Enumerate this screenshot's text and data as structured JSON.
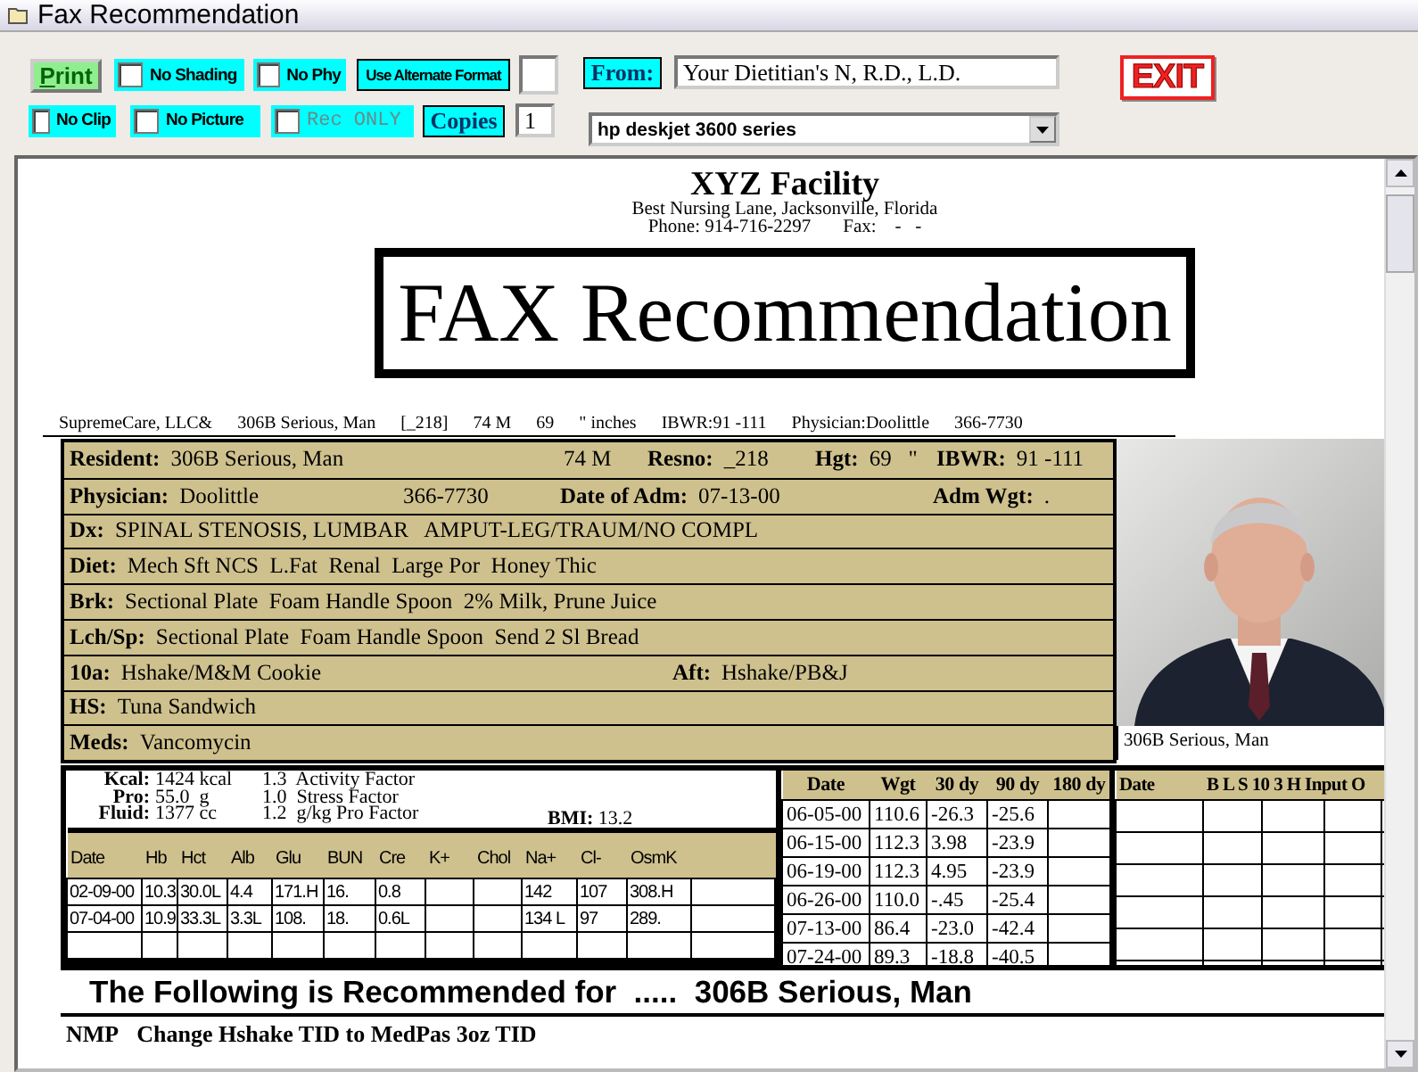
{
  "window": {
    "title": "Fax Recommendation"
  },
  "toolbar": {
    "print": "Print",
    "row1_options": [
      {
        "label": "No Shading",
        "checked": false,
        "disabled": false
      },
      {
        "label": "No Phy",
        "checked": false,
        "disabled": false
      }
    ],
    "alternate_format": "Use Alternate Format",
    "from_label": "From:",
    "from_value": "Your Dietitian's N, R.D., L.D.",
    "exit": "EXIT",
    "row2_options": [
      {
        "label": "No Clip",
        "checked": false,
        "disabled": false
      },
      {
        "label": "No Picture",
        "checked": false,
        "disabled": false
      },
      {
        "label": "Rec ONLY",
        "checked": false,
        "disabled": true
      }
    ],
    "copies_label": "Copies",
    "copies": "1",
    "printer": "hp deskjet 3600 series"
  },
  "facility": {
    "name": "XYZ Facility",
    "address": "Best Nursing Lane, Jacksonville, Florida",
    "phone": "Phone: 914-716-2297",
    "fax": "Fax:    -   -"
  },
  "title": "FAX Recommendation",
  "summary": [
    "SupremeCare, LLC&",
    "306B Serious, Man",
    "[_218]",
    "74 M",
    "69",
    "\" inches",
    "IBWR:91 -111",
    "Physician:Doolittle",
    "366-7730"
  ],
  "resident_rows": [
    [
      {
        "label": "Resident:",
        "value": "306B Serious, Man"
      },
      {
        "value": "74 M"
      },
      {
        "label": "Resno:",
        "value": "_218"
      },
      {
        "label": "Hgt:",
        "value": "69   \""
      },
      {
        "label": "IBWR:",
        "value": "91 -111"
      }
    ],
    [
      {
        "label": "Physician:",
        "value": "Doolittle"
      },
      {
        "value": "366-7730"
      },
      {
        "label": "Date of Adm:",
        "value": "07-13-00"
      },
      {
        "label": "Adm Wgt:",
        "value": "."
      }
    ],
    [
      {
        "label": "Dx:",
        "value": "SPINAL STENOSIS, LUMBAR   AMPUT-LEG/TRAUM/NO COMPL"
      }
    ],
    [
      {
        "label": "Diet:",
        "value": "Mech Sft NCS  L.Fat  Renal  Large Por  Honey Thic"
      }
    ],
    [
      {
        "label": "Brk:",
        "value": "Sectional Plate  Foam Handle Spoon  2% Milk, Prune Juice"
      }
    ],
    [
      {
        "label": "Lch/Sp:",
        "value": "Sectional Plate  Foam Handle Spoon  Send 2 Sl Bread"
      }
    ],
    [
      {
        "label": "10a:",
        "value": "Hshake/M&M Cookie"
      },
      {
        "label": "Aft:",
        "value": "Hshake/PB&J"
      }
    ],
    [
      {
        "label": "HS:",
        "value": "Tuna Sandwich"
      }
    ],
    [
      {
        "label": "Meds:",
        "value": "Vancomycin"
      }
    ]
  ],
  "photo": {
    "kind": "picture",
    "caption": "306B Serious, Man"
  },
  "nutrition": {
    "lines": [
      {
        "label": "Kcal:",
        "value": "1424 kcal",
        "factor": "1.3  Activity Factor"
      },
      {
        "label": "Pro:",
        "value": "55.0  g",
        "factor": "1.0  Stress Factor"
      },
      {
        "label": "Fluid:",
        "value": "1377 cc",
        "factor": "1.2  g/kg Pro Factor"
      }
    ],
    "bmi_label": "BMI:",
    "bmi": "13.2"
  },
  "labs": {
    "columns": [
      "Date",
      "Hb",
      "Hct",
      "Alb",
      "Glu",
      "BUN",
      "Cre",
      "K+",
      "Chol",
      "Na+",
      "Cl-",
      "OsmK"
    ],
    "rows": [
      [
        "02-09-00",
        "10.3",
        "30.0L",
        "4.4",
        "171.H",
        "16.",
        "0.8",
        null,
        null,
        "142",
        "107",
        "308.H"
      ],
      [
        "07-04-00",
        "10.9",
        "33.3L",
        "3.3L",
        "108.",
        "18.",
        "0.6L",
        null,
        null,
        "134 L",
        "97",
        "289."
      ]
    ]
  },
  "weights": {
    "columns": [
      "Date",
      "Wgt",
      "30 dy",
      "90 dy",
      "180 dy"
    ],
    "rows": [
      [
        "06-05-00",
        "110.6",
        "-26.3",
        "-25.6",
        null
      ],
      [
        "06-15-00",
        "112.3",
        "3.98",
        "-23.9",
        null
      ],
      [
        "06-19-00",
        "112.3",
        "4.95",
        "-23.9",
        null
      ],
      [
        "06-26-00",
        "110.0",
        "-.45",
        "-25.4",
        null
      ],
      [
        "07-13-00",
        "86.4",
        "-23.0",
        "-42.4",
        null
      ],
      [
        "07-24-00",
        "89.3",
        "-18.8",
        "-40.5",
        null
      ]
    ]
  },
  "intake": {
    "columns": [
      "Date",
      "B L S 10 3 H Input O"
    ]
  },
  "recommendation": {
    "heading": "The Following is Recommended for  .....  306B Serious, Man",
    "code": "NMP",
    "text": "Change Hshake TID to MedPas 3oz TID"
  }
}
